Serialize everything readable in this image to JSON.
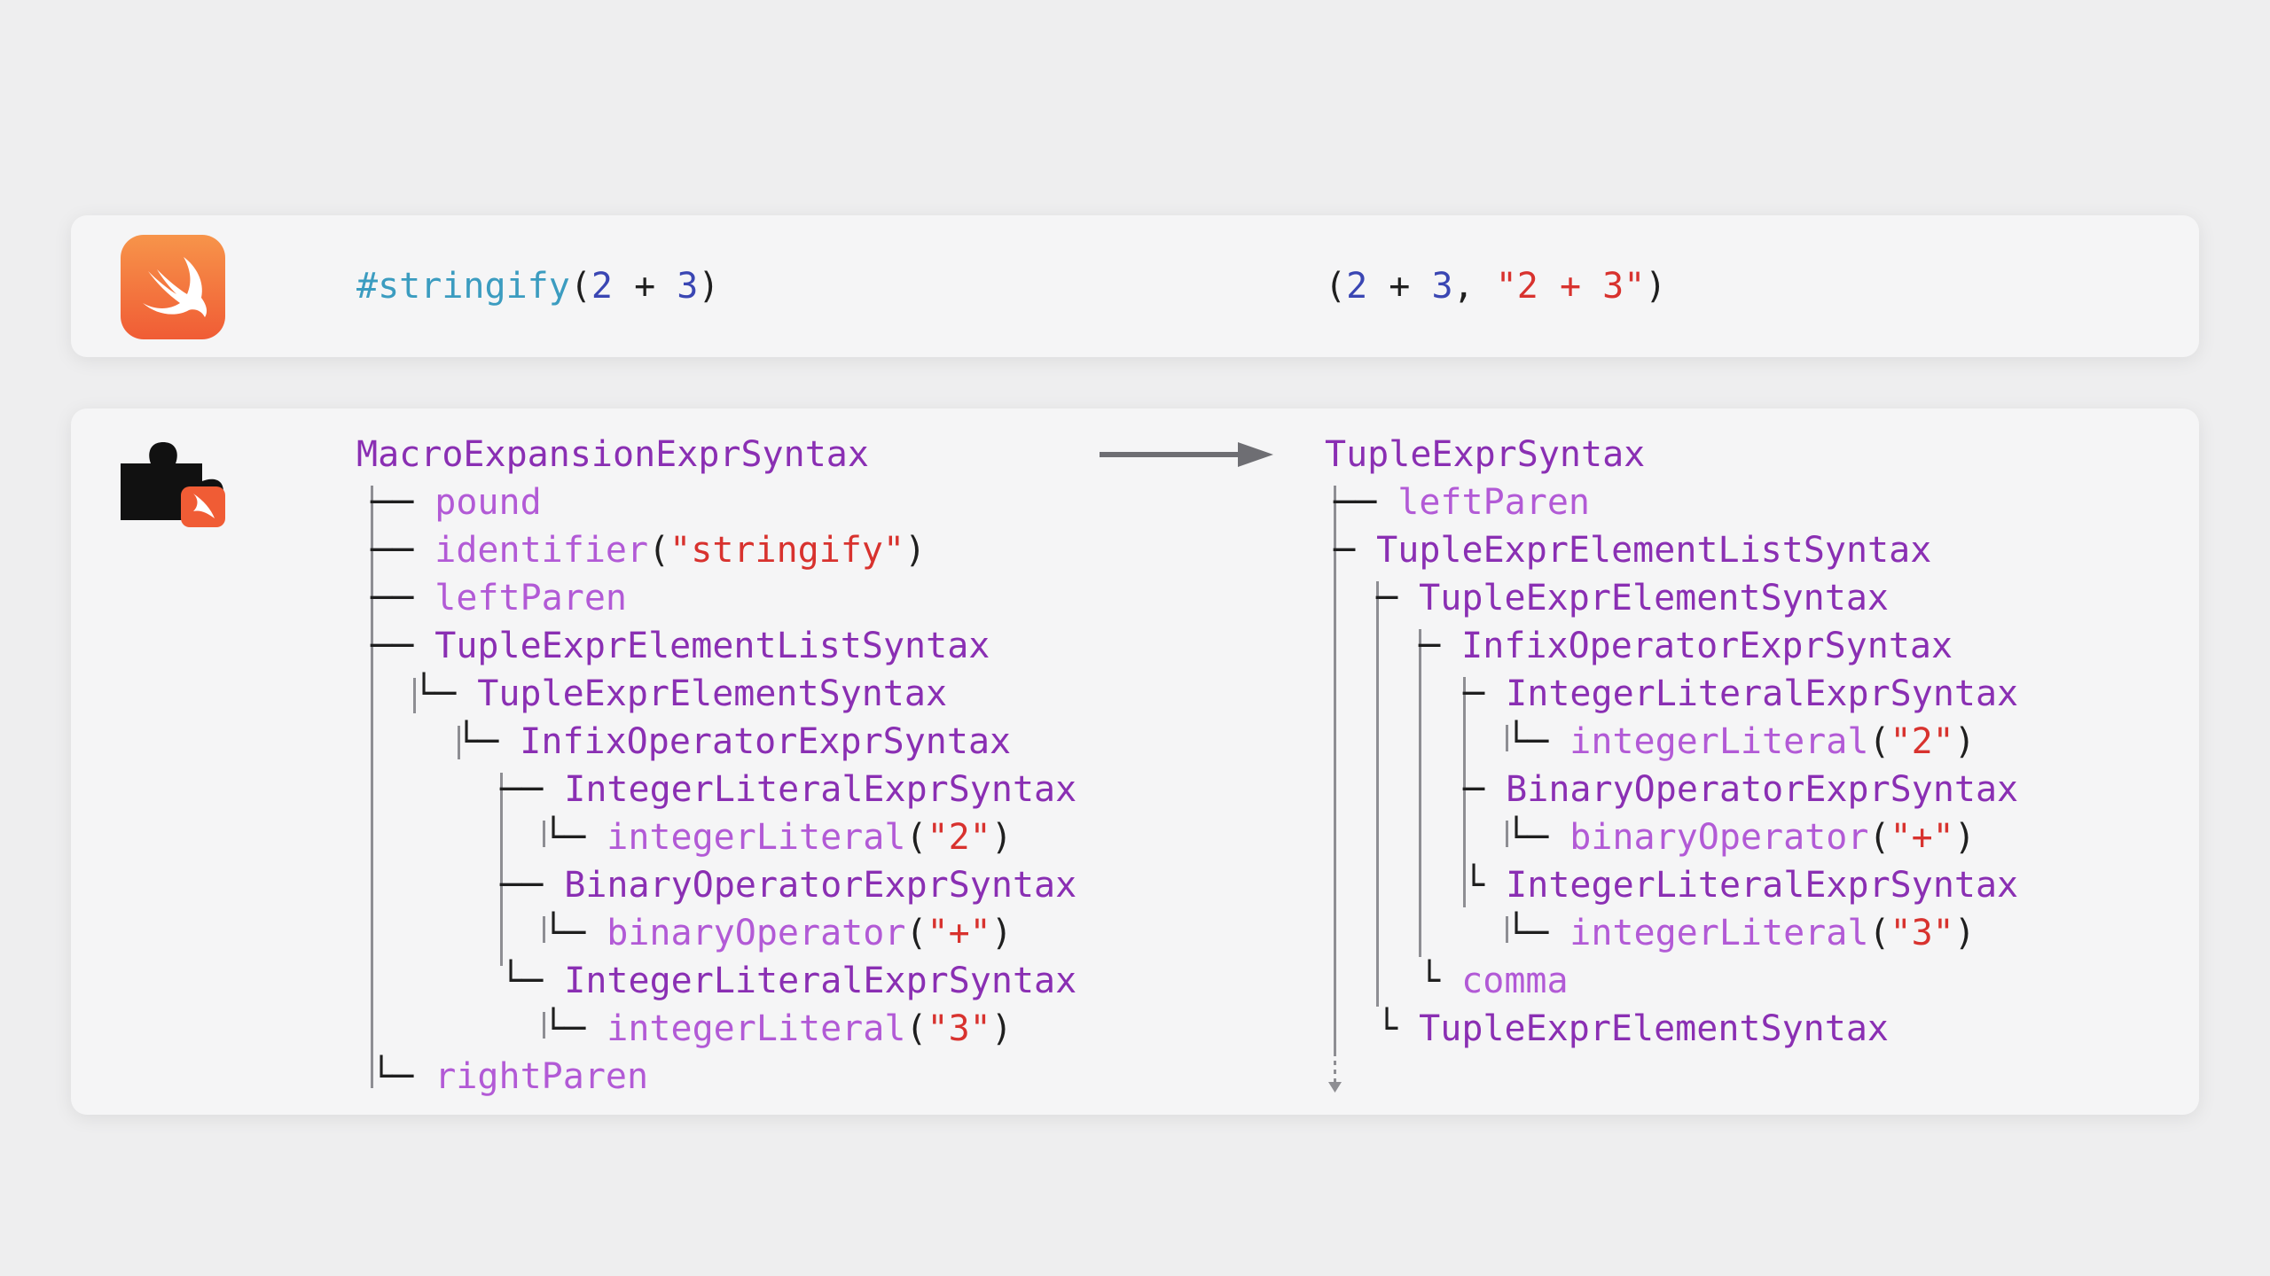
{
  "top": {
    "macro_call": {
      "name": "#stringify",
      "open": "(",
      "a": "2",
      "op": " + ",
      "b": "3",
      "close": ")"
    },
    "result": {
      "open": "(",
      "a": "2",
      "op": " + ",
      "b": "3",
      "sep": ", ",
      "str": "\"2 + 3\"",
      "close": ")"
    }
  },
  "left_tree": {
    "root": "MacroExpansionExprSyntax",
    "pound": "pound",
    "identifier": "identifier",
    "identifier_value": "\"stringify\"",
    "leftParen": "leftParen",
    "list": "TupleExprElementListSyntax",
    "element": "TupleExprElementSyntax",
    "infix": "InfixOperatorExprSyntax",
    "lit1": "IntegerLiteralExprSyntax",
    "lit1_token": "integerLiteral",
    "lit1_value": "\"2\"",
    "binop": "BinaryOperatorExprSyntax",
    "binop_token": "binaryOperator",
    "binop_value": "\"+\"",
    "lit2": "IntegerLiteralExprSyntax",
    "lit2_token": "integerLiteral",
    "lit2_value": "\"3\"",
    "rightParen": "rightParen"
  },
  "right_tree": {
    "root": "TupleExprSyntax",
    "leftParen": "leftParen",
    "list": "TupleExprElementListSyntax",
    "element": "TupleExprElementSyntax",
    "infix": "InfixOperatorExprSyntax",
    "lit1": "IntegerLiteralExprSyntax",
    "lit1_token": "integerLiteral",
    "lit1_value": "\"2\"",
    "binop": "BinaryOperatorExprSyntax",
    "binop_token": "binaryOperator",
    "binop_value": "\"+\"",
    "lit2": "IntegerLiteralExprSyntax",
    "lit2_token": "integerLiteral",
    "lit2_value": "\"3\"",
    "comma": "comma",
    "element2": "TupleExprElementSyntax"
  },
  "colors": {
    "macro": "#3b9cc0",
    "number": "#3a46b3",
    "string": "#d8322e",
    "node": "#8a2fb3",
    "token": "#b25ad6",
    "swift_orange": "#f05c35"
  },
  "icons": [
    "swift-logo-icon",
    "macro-plugin-icon",
    "transform-arrow-icon"
  ]
}
